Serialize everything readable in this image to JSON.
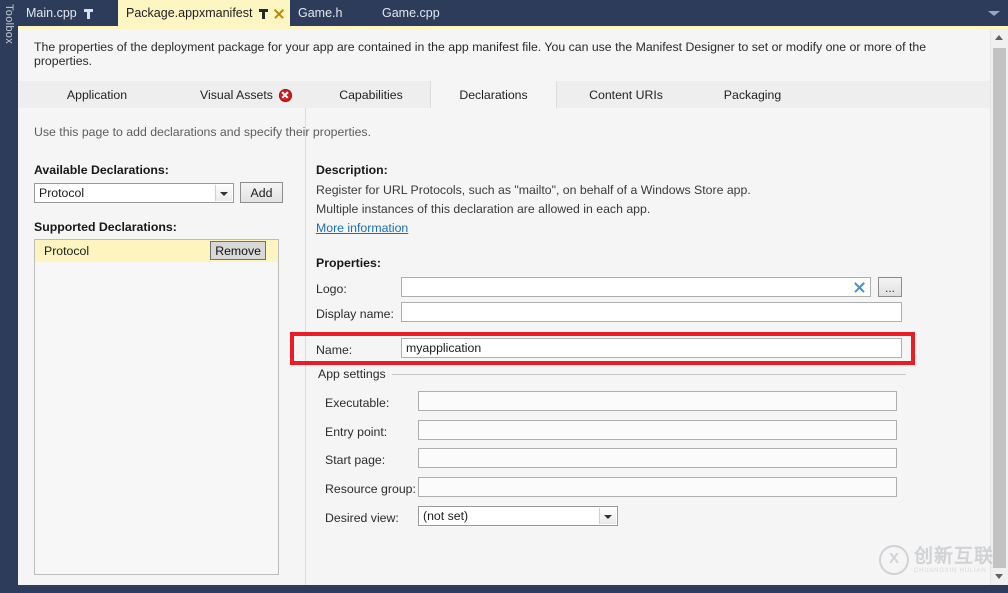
{
  "ide": {
    "toolbox_label": "Toolbox",
    "accent_color": "#fdf6c3",
    "chrome_color": "#2c3c5a"
  },
  "tabbar": {
    "overflow_icon": "chevron-down-icon",
    "tabs": [
      {
        "label": "Main.cpp",
        "active": false,
        "pinned": true,
        "closable": false
      },
      {
        "label": "Package.appxmanifest",
        "active": true,
        "pinned": true,
        "closable": true
      },
      {
        "label": "Game.h",
        "active": false,
        "pinned": false,
        "closable": false
      },
      {
        "label": "Game.cpp",
        "active": false,
        "pinned": false,
        "closable": false
      }
    ]
  },
  "designer": {
    "intro": "The properties of the deployment package for your app are contained in the app manifest file. You can use the Manifest Designer to set or modify one or more of the properties.",
    "pivots": [
      {
        "label": "Application",
        "selected": false,
        "error": false
      },
      {
        "label": "Visual Assets",
        "selected": false,
        "error": true
      },
      {
        "label": "Capabilities",
        "selected": false,
        "error": false
      },
      {
        "label": "Declarations",
        "selected": true,
        "error": false
      },
      {
        "label": "Content URIs",
        "selected": false,
        "error": false
      },
      {
        "label": "Packaging",
        "selected": false,
        "error": false
      }
    ],
    "error_badge_color": "#d01e1e"
  },
  "page": {
    "hint": "Use this page to add declarations and specify their properties.",
    "left": {
      "available_heading": "Available Declarations:",
      "available_selected": "Protocol",
      "add_label": "Add",
      "supported_heading": "Supported Declarations:",
      "supported_items": [
        {
          "label": "Protocol",
          "remove_label": "Remove",
          "selected": true
        }
      ]
    },
    "right": {
      "description_heading": "Description:",
      "description_lines": [
        "Register for URL Protocols, such as \"mailto\", on behalf of a Windows Store app.",
        "Multiple instances of this declaration are allowed in each app."
      ],
      "more_information": "More information",
      "properties_heading": "Properties:",
      "fields": {
        "logo_label": "Logo:",
        "logo_value": "",
        "logo_clear_icon": "close-icon",
        "logo_browse_label": "...",
        "display_name_label": "Display name:",
        "display_name_value": "",
        "name_label": "Name:",
        "name_value": "myapplication"
      },
      "app_settings": {
        "group_label": "App settings",
        "executable_label": "Executable:",
        "executable_value": "",
        "entry_point_label": "Entry point:",
        "entry_point_value": "",
        "start_page_label": "Start page:",
        "start_page_value": "",
        "resource_group_label": "Resource group:",
        "resource_group_value": "",
        "desired_view_label": "Desired view:",
        "desired_view_value": "(not set)"
      }
    }
  },
  "annotation": {
    "color": "#ec1c24",
    "target": "Name field row"
  },
  "watermark": {
    "cn": "创新互联",
    "en": "CHUANGXIN HULIAN"
  }
}
